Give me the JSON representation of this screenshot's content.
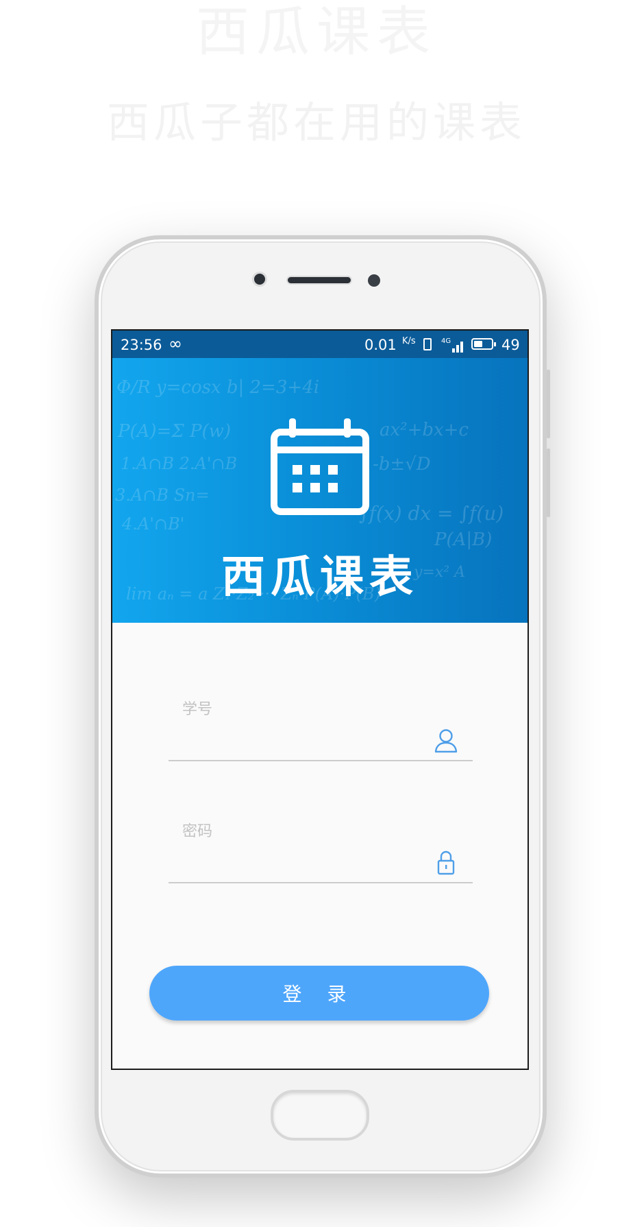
{
  "promo": {
    "line1": "西瓜课表",
    "line2": "西瓜子都在用的课表"
  },
  "status_bar": {
    "time": "23:56",
    "net_speed": "0.01",
    "net_speed_unit": "K/s",
    "signal_label": "4G",
    "battery_level": "49",
    "battery_fraction": 0.49
  },
  "header": {
    "app_name": "西瓜课表"
  },
  "login_form": {
    "student_id_label": "学号",
    "password_label": "密码",
    "login_button": "登 录"
  },
  "colors": {
    "header_start": "#12a6ee",
    "header_end": "#0773bd",
    "button": "#4ea6fb",
    "icon": "#4e9ee8"
  },
  "icons": {
    "user": "person-outline-icon",
    "password": "lock-icon",
    "logo": "calendar-icon"
  }
}
